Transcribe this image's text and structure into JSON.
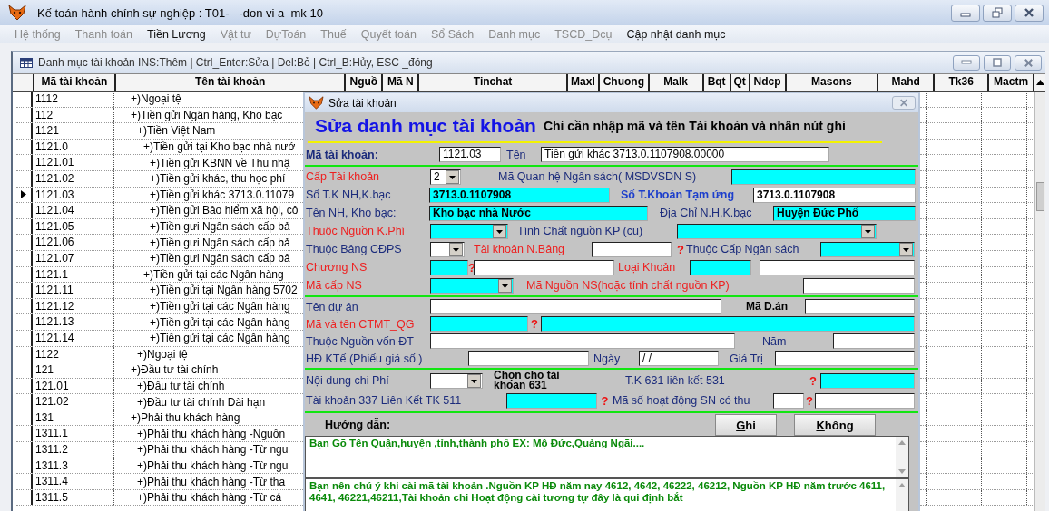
{
  "window": {
    "title": "Kế toán hành chính sự nghiệp : T01-   -don vi a  mk 10"
  },
  "menu": [
    {
      "label": "Hệ thống",
      "disabled": true
    },
    {
      "label": "Thanh toán",
      "disabled": true
    },
    {
      "label": "Tiền Lương",
      "disabled": false
    },
    {
      "label": "Vật tư",
      "disabled": true
    },
    {
      "label": "DựToán",
      "disabled": true
    },
    {
      "label": "Thuế",
      "disabled": true
    },
    {
      "label": "Quyết toán",
      "disabled": true
    },
    {
      "label": "Sổ Sách",
      "disabled": true
    },
    {
      "label": "Danh mục",
      "disabled": true
    },
    {
      "label": "TSCD_Dcụ",
      "disabled": true
    },
    {
      "label": "Cập nhật danh mục",
      "disabled": false
    }
  ],
  "child_window": {
    "title": "Danh mục tài khoản INS:Thêm | Ctrl_Enter:Sửa | Del:Bỏ | Ctrl_B:Hủy, ESC _đóng"
  },
  "grid": {
    "columns": [
      "Mã tài khoản",
      "Tên tài khoản",
      "Nguồ",
      "Mã N",
      "Tinchat",
      "Maxl",
      "Chuong",
      "Malk",
      "Bqt",
      "Qt",
      "Ndcp",
      "Masons",
      "Mahd",
      "Tk36",
      "Mactm"
    ],
    "rows": [
      {
        "code": "1112",
        "name": "+)Ngoại tệ",
        "selected": false
      },
      {
        "code": "112",
        "name": "+)Tiền gửi Ngân hàng, Kho bạc",
        "selected": false,
        "children": [
          {
            "code": "1121",
            "name": "+)Tiền Việt Nam",
            "selected": false,
            "children": [
              {
                "code": "1121.0",
                "name": "+)Tiền gửi tại Kho bạc nhà nướ",
                "selected": false,
                "children": [
                  {
                    "code": "1121.01",
                    "name": "+)Tiền gửi KBNN về Thu nhậ",
                    "selected": false
                  },
                  {
                    "code": "1121.02",
                    "name": "+)Tiền gửi khác, thu học phí",
                    "selected": false
                  },
                  {
                    "code": "1121.03",
                    "name": "+)Tiền gửi khác 3713.0.11079",
                    "selected": true
                  },
                  {
                    "code": "1121.04",
                    "name": "+)Tiền gửi Bảo hiểm xã hội, cô",
                    "selected": false
                  },
                  {
                    "code": "1121.05",
                    "name": "+)Tiền gưi Ngân sách cấp bả",
                    "selected": false
                  },
                  {
                    "code": "1121.06",
                    "name": "+)Tiền gưi Ngân sách cấp bả",
                    "selected": false
                  },
                  {
                    "code": "1121.07",
                    "name": "+)Tiền gưi Ngân sách cấp bả",
                    "selected": false
                  }
                ]
              },
              {
                "code": "1121.1",
                "name": "+)Tiền gửi tại các Ngân hàng",
                "selected": false,
                "children": [
                  {
                    "code": "1121.11",
                    "name": "+)Tiền gửi tại Ngân hàng 5702",
                    "selected": false
                  },
                  {
                    "code": "1121.12",
                    "name": "+)Tiền gửi tại các Ngân hàng",
                    "selected": false
                  },
                  {
                    "code": "1121.13",
                    "name": "+)Tiền gửi tại các Ngân hàng",
                    "selected": false
                  },
                  {
                    "code": "1121.14",
                    "name": "+)Tiền gửi tại các Ngân hàng",
                    "selected": false
                  }
                ]
              }
            ]
          },
          {
            "code": "1122",
            "name": "+)Ngoại tệ",
            "selected": false
          }
        ]
      },
      {
        "code": "121",
        "name": "+)Đầu tư tài chính",
        "selected": false,
        "children": [
          {
            "code": "121.01",
            "name": "+)Đầu tư tài chính",
            "selected": false
          },
          {
            "code": "121.02",
            "name": "+)Đầu tư tài chính Dài hạn",
            "selected": false
          }
        ]
      },
      {
        "code": "131",
        "name": "+)Phải thu khách hàng",
        "selected": false,
        "children": [
          {
            "code": "1311.1",
            "name": "+)Phải thu khách hàng -Nguồn",
            "selected": false
          },
          {
            "code": "1311.2",
            "name": "+)Phải thu khách hàng -Từ ngu",
            "selected": false
          },
          {
            "code": "1311.3",
            "name": "+)Phải thu khách hàng -Từ ngu",
            "selected": false
          },
          {
            "code": "1311.4",
            "name": "+)Phải thu khách hàng -Từ tha",
            "selected": false
          },
          {
            "code": "1311.5",
            "name": "+)Phải thu khách hàng -Từ cá",
            "selected": false
          }
        ]
      }
    ]
  },
  "dialog": {
    "title": "Sửa tài khoản",
    "heading": "Sửa danh mục tài khoản",
    "hint": "Chỉ cần nhập mã và tên Tài khoản và nhấn nút ghi",
    "sections": [
      [
        [
          {
            "kind": "label",
            "text": "Mã tài khoản:",
            "color": "#1c2c7c",
            "emphasized": true
          },
          {
            "kind": "input",
            "value": "1121.03",
            "highlighted": false
          },
          {
            "kind": "label",
            "text": "Tên",
            "color": "#1c2c7c",
            "emphasized": false
          },
          {
            "kind": "input",
            "value": "Tiền gửi khác 3713.0.1107908.00000",
            "highlighted": false
          }
        ]
      ],
      [
        [
          {
            "kind": "label",
            "text": "Cấp Tài khoản",
            "color": "#ee2020",
            "emphasized": false
          },
          {
            "kind": "combo",
            "value": "2",
            "highlighted": false
          },
          {
            "kind": "label",
            "text": "Mã Quan hệ Ngân sách( MSDVSDN S)",
            "color": "#1c2c7c",
            "emphasized": false
          },
          {
            "kind": "input",
            "highlighted": true
          }
        ],
        [
          {
            "kind": "label",
            "text": "Số T.K NH,K.bạc",
            "color": "#1c2c7c",
            "emphasized": false
          },
          {
            "kind": "input",
            "value": "3713.0.1107908",
            "highlighted": true,
            "emphasized": true
          },
          {
            "kind": "label",
            "text": "Số T.Khoản Tạm ứng",
            "color": "#1d3fcc",
            "emphasized": true
          },
          {
            "kind": "input",
            "value": "3713.0.1107908",
            "highlighted": false,
            "emphasized": true
          }
        ],
        [
          {
            "kind": "label",
            "text": "Tên NH, Kho bạc:",
            "color": "#1c2c7c",
            "emphasized": false
          },
          {
            "kind": "input",
            "value": "Kho bạc nhà Nước",
            "highlighted": true,
            "emphasized": true
          },
          {
            "kind": "label",
            "text": "Địa Chỉ N.H,K.bạc",
            "color": "#1c2c7c",
            "emphasized": false
          },
          {
            "kind": "input",
            "value": "Huyện Đức Phổ",
            "highlighted": true,
            "emphasized": true
          }
        ],
        [
          {
            "kind": "label",
            "text": "Thuộc Nguồn K.Phí",
            "color": "#ee2020",
            "emphasized": false
          },
          {
            "kind": "combo",
            "highlighted": true
          },
          {
            "kind": "label",
            "text": "Tính Chất nguồn KP (cũ)",
            "color": "#1c2c7c",
            "emphasized": false
          },
          {
            "kind": "combo",
            "highlighted": true
          }
        ],
        [
          {
            "kind": "label",
            "text": "Thuộc Bảng CĐPS",
            "color": "#1c2c7c",
            "emphasized": false
          },
          {
            "kind": "combo",
            "highlighted": false
          },
          {
            "kind": "label",
            "text": "Tài khoản N.Bảng",
            "color": "#ee2020",
            "emphasized": false
          },
          {
            "kind": "input",
            "highlighted": false
          },
          {
            "kind": "mark",
            "text": "?"
          },
          {
            "kind": "label",
            "text": "Thuộc Cấp Ngân sách",
            "color": "#1c2c7c",
            "emphasized": false
          },
          {
            "kind": "combo",
            "highlighted": true
          }
        ],
        [
          {
            "kind": "label",
            "text": "Chương NS",
            "color": "#ee2020",
            "emphasized": false
          },
          {
            "kind": "input",
            "highlighted": true
          },
          {
            "kind": "mark",
            "text": "?"
          },
          {
            "kind": "input",
            "highlighted": false
          },
          {
            "kind": "label",
            "text": "Loại Khoản",
            "color": "#ee2020",
            "emphasized": false
          },
          {
            "kind": "input",
            "highlighted": true
          },
          {
            "kind": "input",
            "highlighted": false
          }
        ],
        [
          {
            "kind": "label",
            "text": "Mã cấp NS",
            "color": "#ee2020",
            "emphasized": false
          },
          {
            "kind": "combo",
            "highlighted": true
          },
          {
            "kind": "label",
            "text": "Mã Nguồn NS(hoặc tính chất nguồn KP)",
            "color": "#ee2020",
            "emphasized": false
          },
          {
            "kind": "input",
            "highlighted": false
          }
        ]
      ],
      [
        [
          {
            "kind": "label",
            "text": "Tên dự án",
            "color": "#1c2c7c",
            "emphasized": false
          },
          {
            "kind": "input",
            "highlighted": false
          },
          {
            "kind": "caption",
            "text": "Mã D.án"
          },
          {
            "kind": "input",
            "highlighted": false
          }
        ],
        [
          {
            "kind": "label",
            "text": "Mã và tên CTMT_QG",
            "color": "#ee2020",
            "emphasized": false
          },
          {
            "kind": "input",
            "highlighted": true
          },
          {
            "kind": "mark",
            "text": "?"
          },
          {
            "kind": "input",
            "highlighted": true
          }
        ],
        [
          {
            "kind": "label",
            "text": "Thuộc Nguồn vốn ĐT",
            "color": "#1c2c7c",
            "emphasized": false
          },
          {
            "kind": "input",
            "highlighted": false
          },
          {
            "kind": "label",
            "text": "Năm",
            "color": "#1c2c7c",
            "emphasized": false
          },
          {
            "kind": "input",
            "highlighted": false
          }
        ],
        [
          {
            "kind": "label",
            "text": "HĐ KTế (Phiếu giá số )",
            "color": "#1c2c7c",
            "emphasized": false
          },
          {
            "kind": "input",
            "highlighted": false
          },
          {
            "kind": "label",
            "text": "Ngày",
            "color": "#1c2c7c",
            "emphasized": false
          },
          {
            "kind": "input",
            "value": "/ /",
            "highlighted": false
          },
          {
            "kind": "label",
            "text": "Giá Trị",
            "color": "#1c2c7c",
            "emphasized": false
          },
          {
            "kind": "input",
            "highlighted": false
          }
        ]
      ],
      [
        [
          {
            "kind": "label",
            "text": "Nội dung chi Phí",
            "color": "#1c2c7c",
            "emphasized": false
          },
          {
            "kind": "combo",
            "highlighted": false
          },
          {
            "kind": "caption",
            "text": "Chọn cho tài khoản 631"
          },
          {
            "kind": "label",
            "text": "T.K 631 liên kết 531",
            "color": "#1c2c7c",
            "emphasized": false
          },
          {
            "kind": "mark",
            "text": "?"
          },
          {
            "kind": "input",
            "highlighted": true
          }
        ],
        [
          {
            "kind": "label",
            "text": "Tài khoản 337 Liên Kết TK 511",
            "color": "#1c2c7c",
            "emphasized": false
          },
          {
            "kind": "input",
            "highlighted": true
          },
          {
            "kind": "mark",
            "text": "?"
          },
          {
            "kind": "label",
            "text": "Mã số hoạt động SN có thu",
            "color": "#1c2c7c",
            "emphasized": false
          },
          {
            "kind": "input",
            "highlighted": false
          },
          {
            "kind": "mark",
            "text": "?"
          },
          {
            "kind": "input",
            "highlighted": false
          }
        ]
      ]
    ],
    "guide_label": "Hướng dẫn:",
    "buttons": [
      {
        "label": "Ghi"
      },
      {
        "label": "Không"
      }
    ],
    "notes": [
      "Bạn Gõ Tên Quận,huyện ,tỉnh,thành phố EX: Mộ Đức,Quảng Ngãi....",
      "Bạn nên chú ý khi cài mã tài khoản .Nguồn KP HĐ năm nay 4612, 4642, 46222, 46212, Nguồn KP HĐ năm trước 4611, 4641, 46221,46211,Tài khoản chi Hoạt động cài tương tự đây là qui định bắt"
    ]
  }
}
